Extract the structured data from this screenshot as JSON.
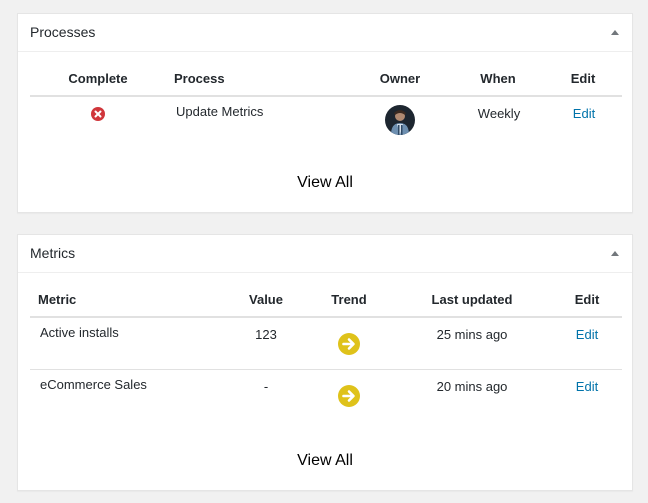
{
  "processes": {
    "title": "Processes",
    "columns": [
      "Complete",
      "Process",
      "Owner",
      "When",
      "Edit"
    ],
    "rows": [
      {
        "complete_icon": "x-circle-icon",
        "process": "Update Metrics",
        "owner_icon": "avatar",
        "when": "Weekly",
        "edit": "Edit"
      }
    ],
    "view_all": "View All"
  },
  "metrics": {
    "title": "Metrics",
    "columns": [
      "Metric",
      "Value",
      "Trend",
      "Last updated",
      "Edit"
    ],
    "rows": [
      {
        "metric": "Active installs",
        "value": "123",
        "trend_icon": "arrow-right-circle-icon",
        "last_updated": "25 mins ago",
        "edit": "Edit"
      },
      {
        "metric": "eCommerce Sales",
        "value": "-",
        "trend_icon": "arrow-right-circle-icon",
        "last_updated": "20 mins ago",
        "edit": "Edit"
      }
    ],
    "view_all": "View All"
  },
  "colors": {
    "background": "#f1f1f1",
    "link": "#0073aa",
    "fail": "#d0363b",
    "trend": "#dfc21a"
  }
}
